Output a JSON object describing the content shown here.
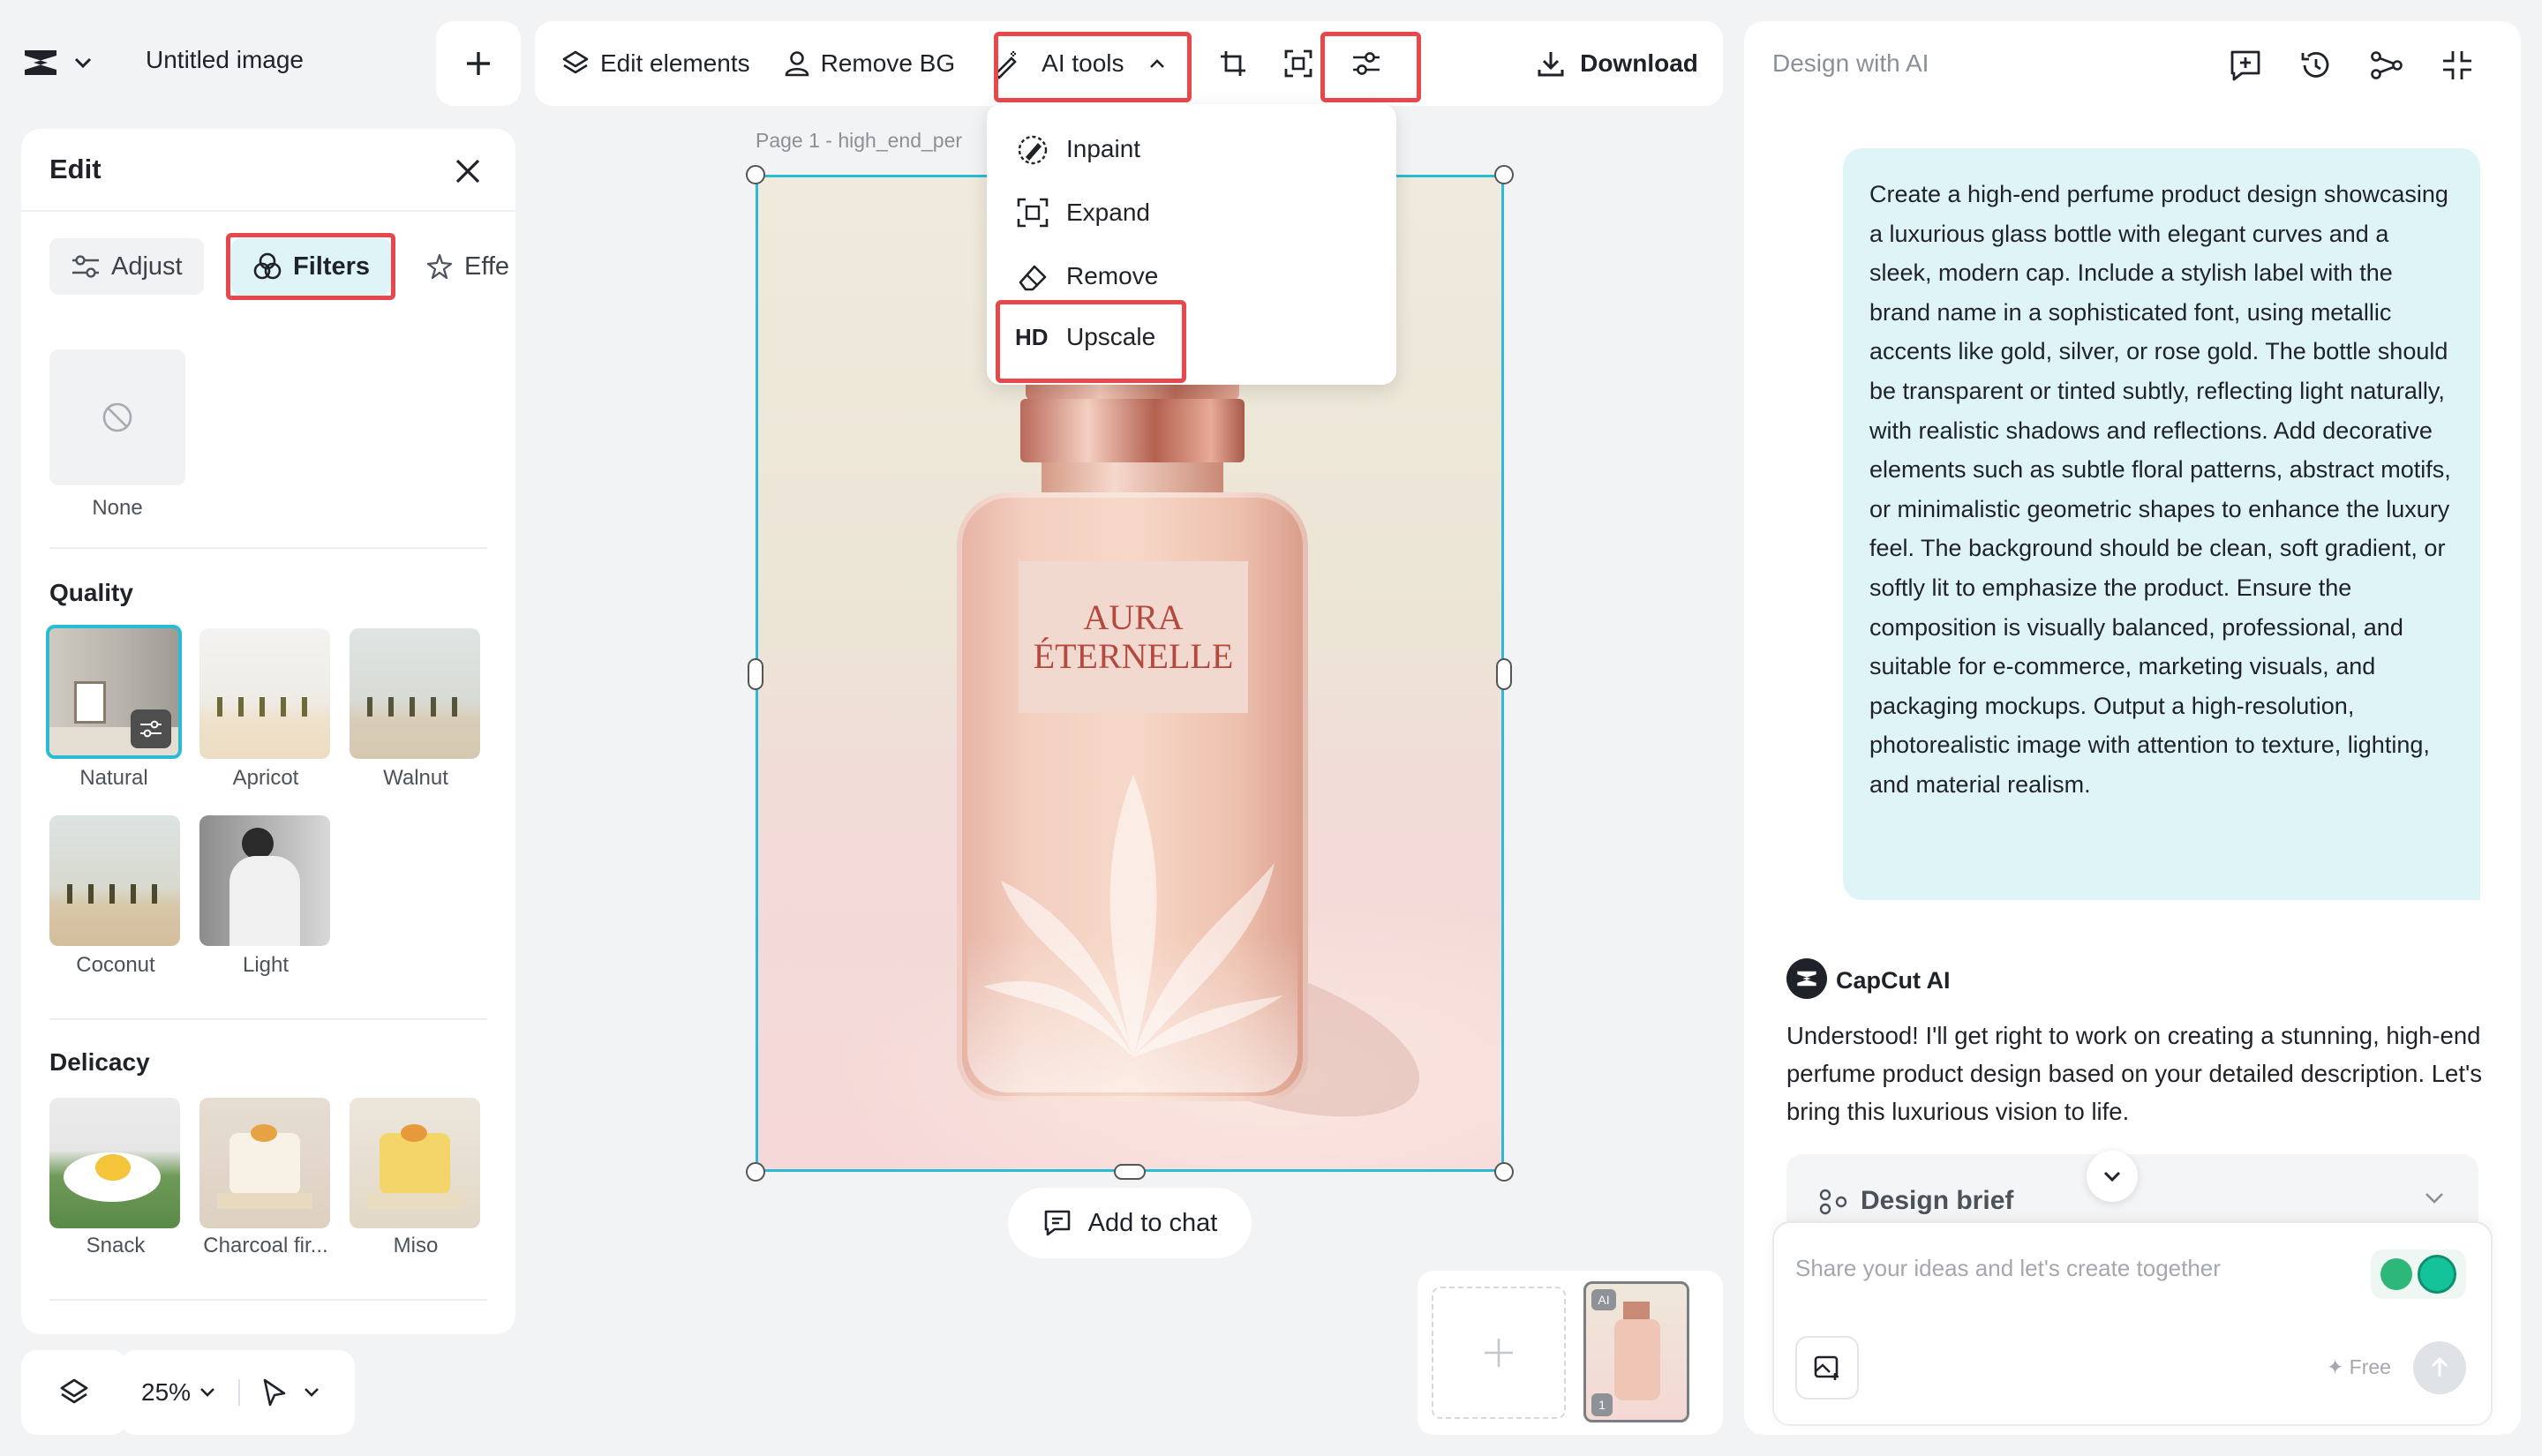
{
  "app": {
    "title": "Untitled image"
  },
  "toolbar": {
    "edit_elements": "Edit elements",
    "remove_bg": "Remove BG",
    "ai_tools": "AI tools",
    "download": "Download"
  },
  "ai_menu": {
    "items": [
      {
        "label": "Inpaint",
        "icon": "inpaint-icon"
      },
      {
        "label": "Expand",
        "icon": "expand-icon"
      },
      {
        "label": "Remove",
        "icon": "eraser-icon"
      },
      {
        "label": "Upscale",
        "icon": "hd-icon",
        "prefix": "HD"
      }
    ]
  },
  "edit_panel": {
    "title": "Edit",
    "tabs": [
      "Adjust",
      "Filters",
      "Effe"
    ],
    "none_label": "None",
    "quality": {
      "title": "Quality",
      "items": [
        "Natural",
        "Apricot",
        "Walnut",
        "Coconut",
        "Light"
      ]
    },
    "delicacy": {
      "title": "Delicacy",
      "items": [
        "Snack",
        "Charcoal fir...",
        "Miso"
      ]
    }
  },
  "canvas": {
    "page_label": "Page 1 -  high_end_per",
    "bottle_label_line1": "AURA",
    "bottle_label_line2": "ÉTERNELLE",
    "add_to_chat": "Add to chat"
  },
  "bottom": {
    "zoom": "25%"
  },
  "pages": {
    "thumb_badge": "AI",
    "thumb_index": "1"
  },
  "right_panel": {
    "title": "Design with AI",
    "user_message": "Create a high-end perfume product design showcasing a luxurious glass bottle with elegant curves and a sleek, modern cap. Include a stylish label with the brand name in a sophisticated font, using metallic accents like gold, silver, or rose gold. The bottle should be transparent or tinted subtly, reflecting light naturally, with realistic shadows and reflections. Add decorative elements such as subtle floral patterns, abstract motifs, or minimalistic geometric shapes to enhance the luxury feel. The background should be clean, soft gradient, or softly lit to emphasize the product. Ensure the composition is visually balanced, professional, and suitable for e-commerce, marketing visuals, and packaging mockups. Output a high-resolution, photorealistic image with attention to texture, lighting, and material realism.",
    "ai_name": "CapCut AI",
    "ai_reply": "Understood! I'll get right to work on creating a stunning, high-end perfume product design based on your detailed description. Let's bring this luxurious vision to life.",
    "design_brief": "Design brief",
    "input_placeholder": "Share your ideas and let's create together",
    "free_label": "✦ Free"
  },
  "colors": {
    "accent": "#2bbbd4",
    "highlight": "#e8484b",
    "selected_bg": "#dff4f7"
  }
}
